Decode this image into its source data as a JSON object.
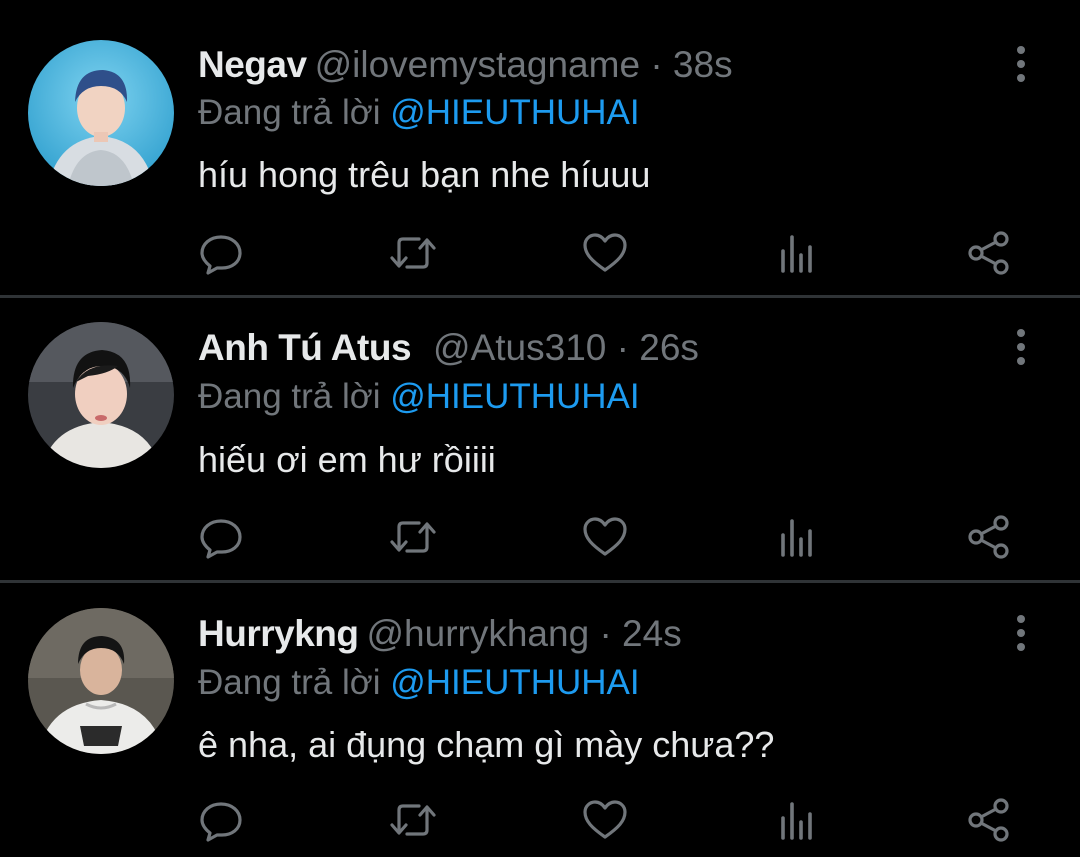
{
  "reply_prefix": "Đang trả lời",
  "tweets": [
    {
      "name": "Negav",
      "handle": "@ilovemystagname",
      "separator": "·",
      "time": "38s",
      "reply_to": "@HIEUTHUHAI",
      "text": "híu hong trêu bạn nhe híuuu"
    },
    {
      "name": "Anh Tú Atus",
      "handle": "@Atus310",
      "separator": "·",
      "time": "26s",
      "reply_to": "@HIEUTHUHAI",
      "text": "hiếu ơi em hư rồiiii"
    },
    {
      "name": "Hurrykng",
      "handle": "@hurrykhang",
      "separator": "·",
      "time": "24s",
      "reply_to": "@HIEUTHUHAI",
      "text": "ê nha, ai đụng chạm gì mày chưa??"
    }
  ],
  "icons": {
    "reply": "reply-icon",
    "retweet": "retweet-icon",
    "like": "like-icon",
    "views": "views-icon",
    "share": "share-icon",
    "more": "more-options-icon"
  },
  "colors": {
    "background": "#000000",
    "text_primary": "#e7e9ea",
    "text_secondary": "#71767b",
    "mention": "#1d9bf0",
    "divider": "#2f3336"
  }
}
